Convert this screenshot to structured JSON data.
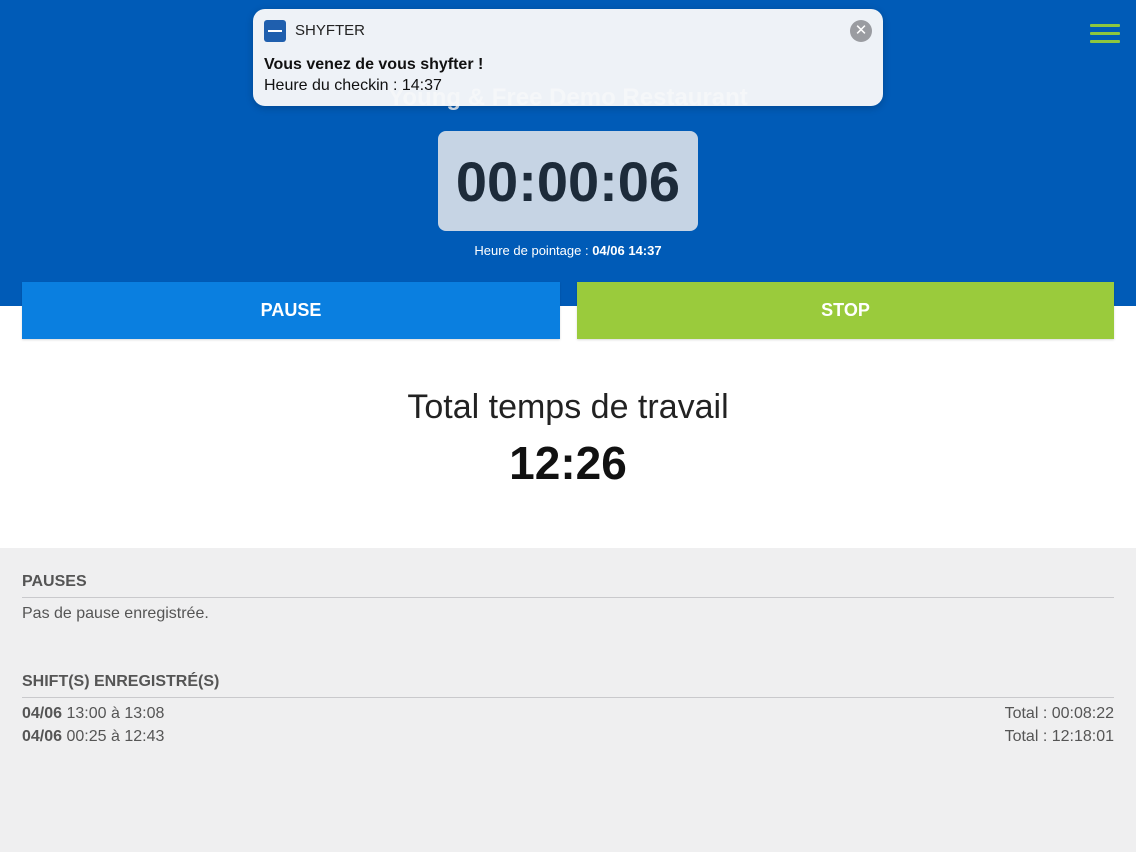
{
  "header": {
    "restaurant_name": "Young & Free Demo Restaurant",
    "menu_icon": "hamburger-menu-icon",
    "accent_color": "#8dc63f",
    "background_color": "#005bb7"
  },
  "timer": {
    "value": "00:00:06"
  },
  "checkin": {
    "label": "Heure de pointage :",
    "value": "04/06 14:37"
  },
  "actions": {
    "pause_label": "PAUSE",
    "stop_label": "STOP",
    "pause_color": "#0a7fe0",
    "stop_color": "#9acb3c"
  },
  "total": {
    "label": "Total temps de travail",
    "value": "12:26"
  },
  "pauses": {
    "title": "PAUSES",
    "empty_text": "Pas de pause enregistrée."
  },
  "shifts": {
    "title": "SHIFT(S) ENREGISTRÉ(S)",
    "rows": [
      {
        "date": "04/06",
        "range": "13:00 à 13:08",
        "total": "Total : 00:08:22"
      },
      {
        "date": "04/06",
        "range": "00:25 à 12:43",
        "total": "Total : 12:18:01"
      }
    ]
  },
  "notification": {
    "app_name": "SHYFTER",
    "app_icon": "shyfter-app-icon",
    "close_icon": "close-icon",
    "title": "Vous venez de vous shyfter !",
    "body": "Heure du checkin : 14:37"
  }
}
